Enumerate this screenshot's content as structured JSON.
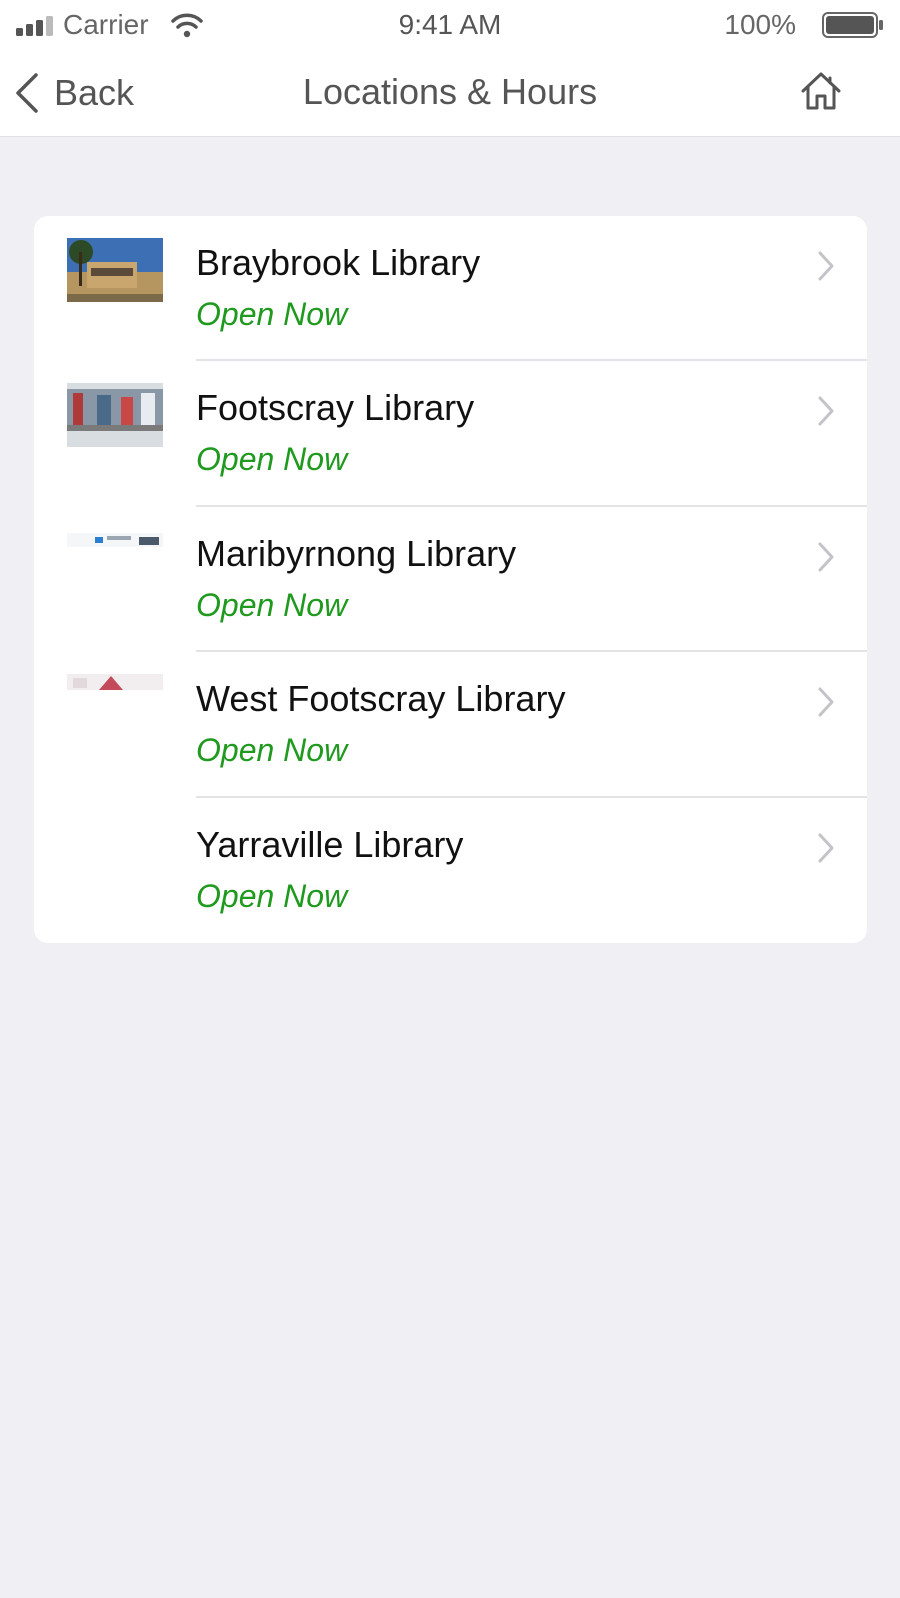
{
  "status_bar": {
    "carrier": "Carrier",
    "time": "9:41 AM",
    "battery": "100%"
  },
  "nav": {
    "back_label": "Back",
    "title": "Locations & Hours",
    "home_icon": "home-icon"
  },
  "colors": {
    "open_status": "#1f9a1f",
    "background": "#efeff4"
  },
  "locations": [
    {
      "name": "Braybrook Library",
      "status": "Open Now"
    },
    {
      "name": "Footscray Library",
      "status": "Open Now"
    },
    {
      "name": "Maribyrnong Library",
      "status": "Open Now"
    },
    {
      "name": "West Footscray Library",
      "status": "Open Now"
    },
    {
      "name": "Yarraville Library",
      "status": "Open Now"
    }
  ]
}
